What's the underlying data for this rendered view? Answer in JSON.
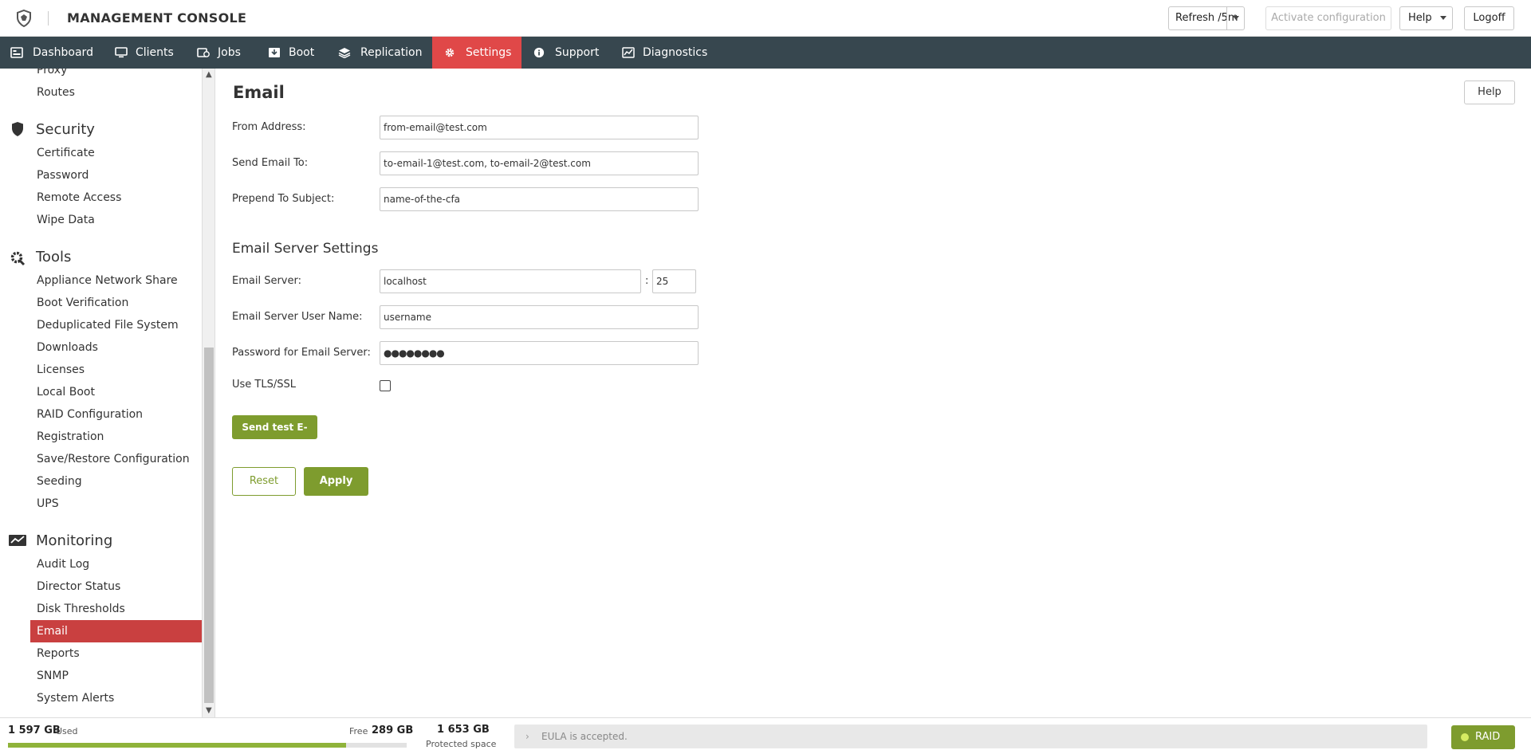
{
  "header": {
    "title": "MANAGEMENT CONSOLE",
    "refresh_label": "Refresh /5m",
    "activate_label": "Activate configuration",
    "help_label": "Help",
    "logoff_label": "Logoff"
  },
  "nav": {
    "items": [
      {
        "label": "Dashboard",
        "icon": "dashboard-icon"
      },
      {
        "label": "Clients",
        "icon": "monitor-icon"
      },
      {
        "label": "Jobs",
        "icon": "jobs-icon"
      },
      {
        "label": "Boot",
        "icon": "boot-icon"
      },
      {
        "label": "Replication",
        "icon": "layers-icon"
      },
      {
        "label": "Settings",
        "icon": "gear-icon",
        "active": true
      },
      {
        "label": "Support",
        "icon": "info-icon"
      },
      {
        "label": "Diagnostics",
        "icon": "chart-icon"
      }
    ]
  },
  "sidebar": {
    "top_links": [
      "Proxy",
      "Routes"
    ],
    "security": {
      "title": "Security",
      "items": [
        "Certificate",
        "Password",
        "Remote Access",
        "Wipe Data"
      ]
    },
    "tools": {
      "title": "Tools",
      "items": [
        "Appliance Network Share",
        "Boot Verification",
        "Deduplicated File System",
        "Downloads",
        "Licenses",
        "Local Boot",
        "RAID Configuration",
        "Registration",
        "Save/Restore Configuration",
        "Seeding",
        "UPS"
      ]
    },
    "monitoring": {
      "title": "Monitoring",
      "items": [
        "Audit Log",
        "Director Status",
        "Disk Thresholds",
        "Email",
        "Reports",
        "SNMP",
        "System Alerts"
      ],
      "active": "Email"
    }
  },
  "main": {
    "title": "Email",
    "help_label": "Help",
    "fields": {
      "from_label": "From Address:",
      "from_value": "from-email@test.com",
      "to_label": "Send Email To:",
      "to_value": "to-email-1@test.com, to-email-2@test.com",
      "prepend_label": "Prepend To Subject:",
      "prepend_value": "name-of-the-cfa"
    },
    "server_section_title": "Email Server Settings",
    "server": {
      "server_label": "Email Server:",
      "server_value": "localhost",
      "port_sep": ":",
      "port_value": "25",
      "user_label": "Email Server User Name:",
      "user_value": "username",
      "password_label": "Password for Email Server:",
      "password_value": "●●●●●●●●",
      "tls_label": "Use TLS/SSL",
      "tls_checked": false
    },
    "test_button": "Send test E-mail",
    "reset_button": "Reset",
    "apply_button": "Apply"
  },
  "footer": {
    "used_value": "1 597 GB",
    "used_label": "Used",
    "free_label": "Free",
    "free_value": "289 GB",
    "usage_fraction": 0.847,
    "protected_value": "1 653 GB",
    "protected_label": "Protected space",
    "eula_text": "EULA is accepted.",
    "raid_label": "RAID"
  },
  "colors": {
    "nav_bg": "#37474f",
    "accent_red": "#e04848",
    "accent_green": "#7e9c2e"
  }
}
